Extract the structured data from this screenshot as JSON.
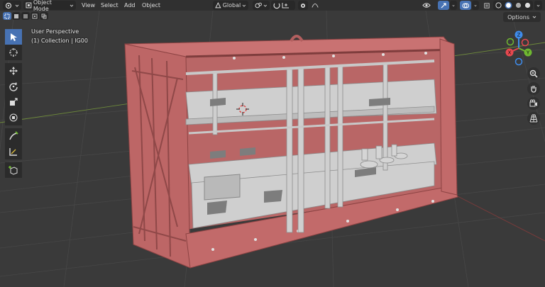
{
  "header": {
    "mode_label": "Object Mode",
    "menus": [
      "View",
      "Select",
      "Add",
      "Object"
    ],
    "transform_orientation": "Global",
    "options_label": "Options"
  },
  "viewport": {
    "perspective_label": "User Perspective",
    "collection_label": "(1) Collection | IG00"
  },
  "gizmo": {
    "x_label": "X",
    "y_label": "Y",
    "z_label": "Z",
    "colors": {
      "x": "#e8484f",
      "y": "#6fb831",
      "z": "#3f8ceb"
    }
  },
  "toolbar": {
    "tools": [
      "select-box",
      "cursor",
      "move",
      "rotate",
      "scale",
      "transform",
      "annotate",
      "measure",
      "add-cube"
    ],
    "active_tool": "select-box"
  },
  "colors": {
    "container": "#c46a6a",
    "container_dark": "#9c4f4f",
    "rack": "#c9c9c9",
    "viewport_bg": "#3a3a3a",
    "accent": "#4772b3"
  }
}
